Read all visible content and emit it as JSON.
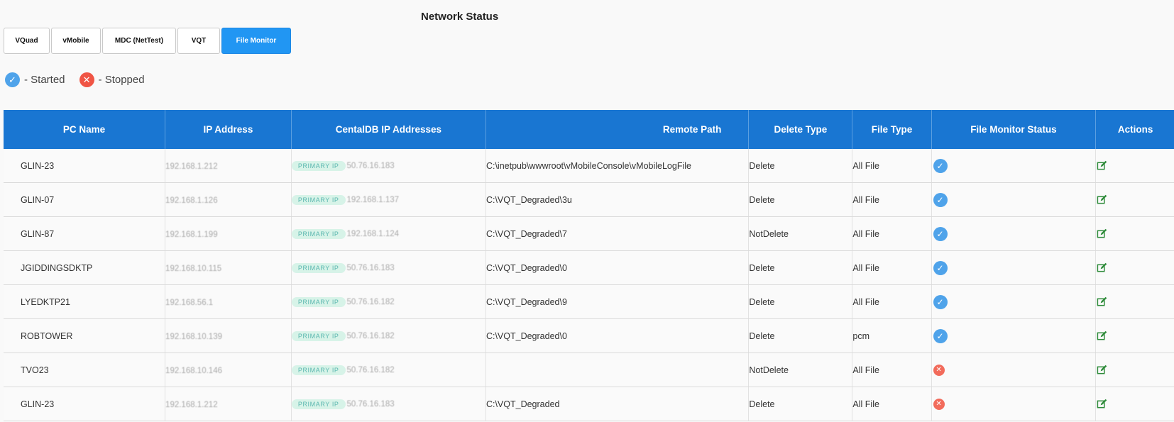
{
  "page": {
    "title": "Network Status"
  },
  "tabs": [
    {
      "label": "VQuad",
      "active": false
    },
    {
      "label": "vMobile",
      "active": false
    },
    {
      "label": "MDC (NetTest)",
      "active": false
    },
    {
      "label": "VQT",
      "active": false
    },
    {
      "label": "File Monitor",
      "active": true
    }
  ],
  "legend": {
    "started": {
      "icon": "check-circle-icon",
      "label": "- Started",
      "color": "#4fa3ea"
    },
    "stopped": {
      "icon": "x-circle-icon",
      "label": "- Stopped",
      "color": "#f05545"
    }
  },
  "table": {
    "header_color": "#1976d2",
    "columns": [
      "PC Name",
      "IP Address",
      "CentalDB IP Addresses",
      "Remote Path",
      "Delete Type",
      "File Type",
      "File Monitor Status",
      "Actions"
    ],
    "ip_badge": "PRIMARY IP",
    "rows": [
      {
        "pc": "GLIN-23",
        "ip": "192.168.1.212",
        "central_ip": "50.76.16.183",
        "path": "C:\\inetpub\\wwwroot\\vMobileConsole\\vMobileLogFile",
        "delete_type": "Delete",
        "file_type": "All File",
        "status": "started"
      },
      {
        "pc": "GLIN-07",
        "ip": "192.168.1.126",
        "central_ip": "192.168.1.137",
        "path": "C:\\VQT_Degraded\\3u",
        "delete_type": "Delete",
        "file_type": "All File",
        "status": "started"
      },
      {
        "pc": "GLIN-87",
        "ip": "192.168.1.199",
        "central_ip": "192.168.1.124",
        "path": "C:\\VQT_Degraded\\7",
        "delete_type": "NotDelete",
        "file_type": "All File",
        "status": "started"
      },
      {
        "pc": "JGIDDINGSDKTP",
        "ip": "192.168.10.115",
        "central_ip": "50.76.16.183",
        "path": "C:\\VQT_Degraded\\0",
        "delete_type": "Delete",
        "file_type": "All File",
        "status": "started"
      },
      {
        "pc": "LYEDKTP21",
        "ip": "192.168.56.1",
        "central_ip": "50.76.16.182",
        "path": "C:\\VQT_Degraded\\9",
        "delete_type": "Delete",
        "file_type": "All File",
        "status": "started"
      },
      {
        "pc": "ROBTOWER",
        "ip": "192.168.10.139",
        "central_ip": "50.76.16.182",
        "path": "C:\\VQT_Degraded\\0",
        "delete_type": "Delete",
        "file_type": "pcm",
        "status": "started"
      },
      {
        "pc": "TVO23",
        "ip": "192.168.10.146",
        "central_ip": "50.76.16.182",
        "path": "",
        "delete_type": "NotDelete",
        "file_type": "All File",
        "status": "stopped"
      },
      {
        "pc": "GLIN-23",
        "ip": "192.168.1.212",
        "central_ip": "50.76.16.183",
        "path": "C:\\VQT_Degraded",
        "delete_type": "Delete",
        "file_type": "All File",
        "status": "stopped"
      }
    ]
  }
}
